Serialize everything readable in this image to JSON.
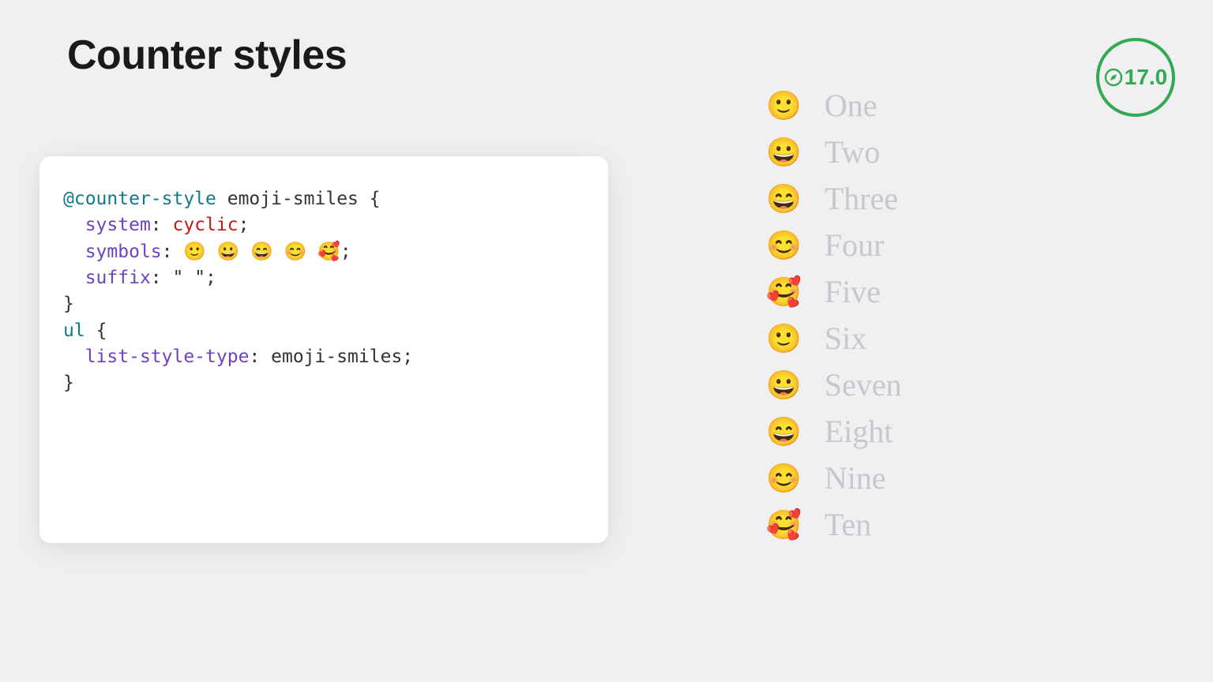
{
  "title": "Counter styles",
  "badge": {
    "version": "17.0",
    "icon": "compass-icon"
  },
  "code": {
    "rule_keyword": "@counter-style",
    "rule_name": "emoji-smiles",
    "open_brace": "{",
    "prop_system": "system",
    "val_system": "cyclic",
    "prop_symbols": "symbols",
    "val_symbols": "🙂 😀 😄 😊 🥰",
    "prop_suffix": "suffix",
    "val_suffix": "\" \"",
    "close_brace": "}",
    "selector": "ul",
    "prop_lst": "list-style-type",
    "val_lst": "emoji-smiles"
  },
  "list": {
    "markers": [
      "🙂",
      "😀",
      "😄",
      "😊",
      "🥰",
      "🙂",
      "😀",
      "😄",
      "😊",
      "🥰"
    ],
    "items": [
      "One",
      "Two",
      "Three",
      "Four",
      "Five",
      "Six",
      "Seven",
      "Eight",
      "Nine",
      "Ten"
    ]
  },
  "colors": {
    "badge_green": "#34a853",
    "bg": "#f0f0f2",
    "code_at": "#0f7b8a",
    "code_prop": "#6f42c1",
    "code_val": "#c41a16",
    "list_text": "#c7c7cc"
  }
}
